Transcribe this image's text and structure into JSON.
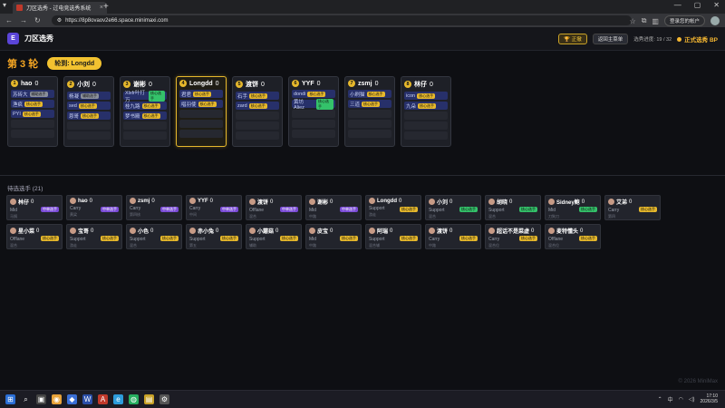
{
  "browser": {
    "tab_title": "刀区选秀 - 过电竞选秀系统",
    "url": "https://8p8ovaov2e66.space.minimaxi.com",
    "login_label": "登录您的帐户"
  },
  "header": {
    "logo_letter": "E",
    "title": "刀区选秀",
    "undo_label": "正撤",
    "back_label": "返回主菜单",
    "progress": "选秀进度: 19 / 32",
    "status": "正式选秀 BP"
  },
  "round": {
    "title": "第 3 轮",
    "turn": "轮到: Longdd"
  },
  "teams": [
    {
      "num": "1",
      "name": "hao",
      "score": "0",
      "active": false,
      "slots": [
        {
          "n": "苏砖大",
          "t": "辅助选手",
          "c": "grey"
        },
        {
          "n": "渔疯",
          "t": "核心选手",
          "c": "gold"
        },
        {
          "n": "PYI",
          "t": "核心选手",
          "c": "gold"
        }
      ]
    },
    {
      "num": "2",
      "name": "小刘",
      "score": "0",
      "active": false,
      "slots": [
        {
          "n": "杨凝",
          "t": "辅助选手",
          "c": "grey"
        },
        {
          "n": "sed",
          "t": "核心选手",
          "c": "gold"
        },
        {
          "n": "恩哥",
          "t": "核心选手",
          "c": "gold"
        }
      ]
    },
    {
      "num": "3",
      "name": "谢彬",
      "score": "0",
      "active": false,
      "slots": [
        {
          "n": "Xlxfr叶打万",
          "t": "核心选手",
          "c": "green"
        },
        {
          "n": "桂九路",
          "t": "核心选手",
          "c": "gold"
        },
        {
          "n": "梦书殿",
          "t": "核心选手",
          "c": "gold"
        }
      ]
    },
    {
      "num": "4",
      "name": "Longdd",
      "score": "0",
      "active": true,
      "slots": [
        {
          "n": "君君",
          "t": "核心选手",
          "c": "gold"
        },
        {
          "n": "唱羽使",
          "t": "核心选手",
          "c": "gold"
        }
      ]
    },
    {
      "num": "5",
      "name": "渡饼",
      "score": "0",
      "active": false,
      "slots": [
        {
          "n": "石手",
          "t": "核心选手",
          "c": "gold"
        },
        {
          "n": "zard",
          "t": "核心选手",
          "c": "gold"
        }
      ]
    },
    {
      "num": "6",
      "name": "YYF",
      "score": "0",
      "active": false,
      "slots": [
        {
          "n": "dondi",
          "t": "核心选手",
          "c": "gold"
        },
        {
          "n": "黄坊 Aliez",
          "t": "核心选手",
          "c": "green"
        }
      ]
    },
    {
      "num": "7",
      "name": "zsmj",
      "score": "0",
      "active": false,
      "slots": [
        {
          "n": "小刷猫",
          "t": "核心选手",
          "c": "gold"
        },
        {
          "n": "三道",
          "t": "核心选手",
          "c": "gold"
        }
      ]
    },
    {
      "num": "8",
      "name": "林仔",
      "score": "0",
      "active": false,
      "slots": [
        {
          "n": "icon",
          "t": "核心选手",
          "c": "gold"
        },
        {
          "n": "九朵",
          "t": "核心选手",
          "c": "gold"
        }
      ]
    }
  ],
  "pool": {
    "title": "待选选手 (21)",
    "players": [
      {
        "name": "林仔",
        "score": "0",
        "role": "Mid",
        "sub": "马锅",
        "tag": "中单选手",
        "c": "purple"
      },
      {
        "name": "hao",
        "score": "0",
        "role": "Carry",
        "sub": "黄梁",
        "tag": "中单选手",
        "c": "purple"
      },
      {
        "name": "zsmj",
        "score": "0",
        "role": "Carry",
        "sub": "第四核",
        "tag": "中单选手",
        "c": "purple"
      },
      {
        "name": "YYF",
        "score": "0",
        "role": "Carry",
        "sub": "中间",
        "tag": "中单选手",
        "c": "purple"
      },
      {
        "name": "渡饼",
        "score": "0",
        "role": "Offlane",
        "sub": "混合",
        "tag": "中单选手",
        "c": "purple"
      },
      {
        "name": "谢彬",
        "score": "0",
        "role": "Mid",
        "sub": "中路",
        "tag": "中单选手",
        "c": "purple"
      },
      {
        "name": "Longdd",
        "score": "0",
        "role": "Support",
        "sub": "游走",
        "tag": "核心选手",
        "c": "gold"
      },
      {
        "name": "小刘",
        "score": "0",
        "role": "Support",
        "sub": "混合",
        "tag": "核心选手",
        "c": "green"
      },
      {
        "name": "胡晓",
        "score": "0",
        "role": "Support",
        "sub": "混合",
        "tag": "核心选手",
        "c": "green"
      },
      {
        "name": "Sidney鲍",
        "score": "0",
        "role": "Mid",
        "sub": "刀狗刀",
        "tag": "核心选手",
        "c": "green"
      },
      {
        "name": "艾弟",
        "score": "0",
        "role": "Carry",
        "sub": "第四",
        "tag": "核心选手",
        "c": "gold"
      },
      {
        "name": "星小菜",
        "score": "0",
        "role": "Offlane",
        "sub": "混合",
        "tag": "核心选手",
        "c": "gold"
      },
      {
        "name": "宝哥",
        "score": "0",
        "role": "Support",
        "sub": "游走",
        "tag": "核心选手",
        "c": "gold"
      },
      {
        "name": "小色",
        "score": "0",
        "role": "Support",
        "sub": "混合",
        "tag": "核心选手",
        "c": "gold"
      },
      {
        "name": "赤小兔",
        "score": "0",
        "role": "Support",
        "sub": "第五",
        "tag": "核心选手",
        "c": "gold"
      },
      {
        "name": "小蘑菇",
        "score": "0",
        "role": "Support",
        "sub": "辅助",
        "tag": "核心选手",
        "c": "gold"
      },
      {
        "name": "皮宝",
        "score": "0",
        "role": "Mid",
        "sub": "中路",
        "tag": "核心选手",
        "c": "gold"
      },
      {
        "name": "阿瑞",
        "score": "0",
        "role": "Support",
        "sub": "混合辅",
        "tag": "核心选手",
        "c": "gold"
      },
      {
        "name": "渡饼",
        "score": "0",
        "role": "Carry",
        "sub": "中路",
        "tag": "核心选手",
        "c": "gold"
      },
      {
        "name": "超话不是菜虚",
        "score": "0",
        "role": "Carry",
        "sub": "混合位",
        "tag": "核心选手",
        "c": "gold"
      },
      {
        "name": "麦特懂头",
        "score": "0",
        "role": "Offlane",
        "sub": "混合位",
        "tag": "核心选手",
        "c": "gold"
      }
    ]
  },
  "footer": {
    "copyright": "© 2026 MiniMax"
  },
  "taskbar": {
    "time": "17:10",
    "date": "2026/3/5",
    "lang": "中"
  }
}
